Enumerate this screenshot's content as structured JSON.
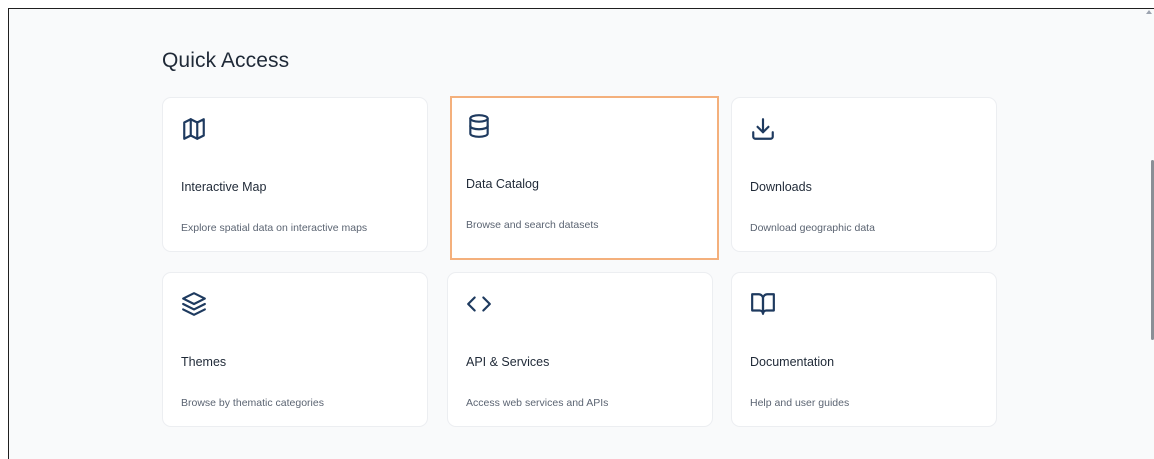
{
  "section": {
    "title": "Quick Access"
  },
  "cards": [
    {
      "icon": "map-icon",
      "title": "Interactive Map",
      "description": "Explore spatial data on interactive maps"
    },
    {
      "icon": "database-icon",
      "title": "Data Catalog",
      "description": "Browse and search datasets"
    },
    {
      "icon": "download-icon",
      "title": "Downloads",
      "description": "Download geographic data"
    },
    {
      "icon": "layers-icon",
      "title": "Themes",
      "description": "Browse by thematic categories"
    },
    {
      "icon": "code-icon",
      "title": "API & Services",
      "description": "Access web services and APIs"
    },
    {
      "icon": "book-icon",
      "title": "Documentation",
      "description": "Help and user guides"
    }
  ],
  "colors": {
    "icon": "#1e3a5f",
    "highlight_border": "#f4b07c",
    "background": "#f9fafb",
    "card": "#ffffff"
  }
}
